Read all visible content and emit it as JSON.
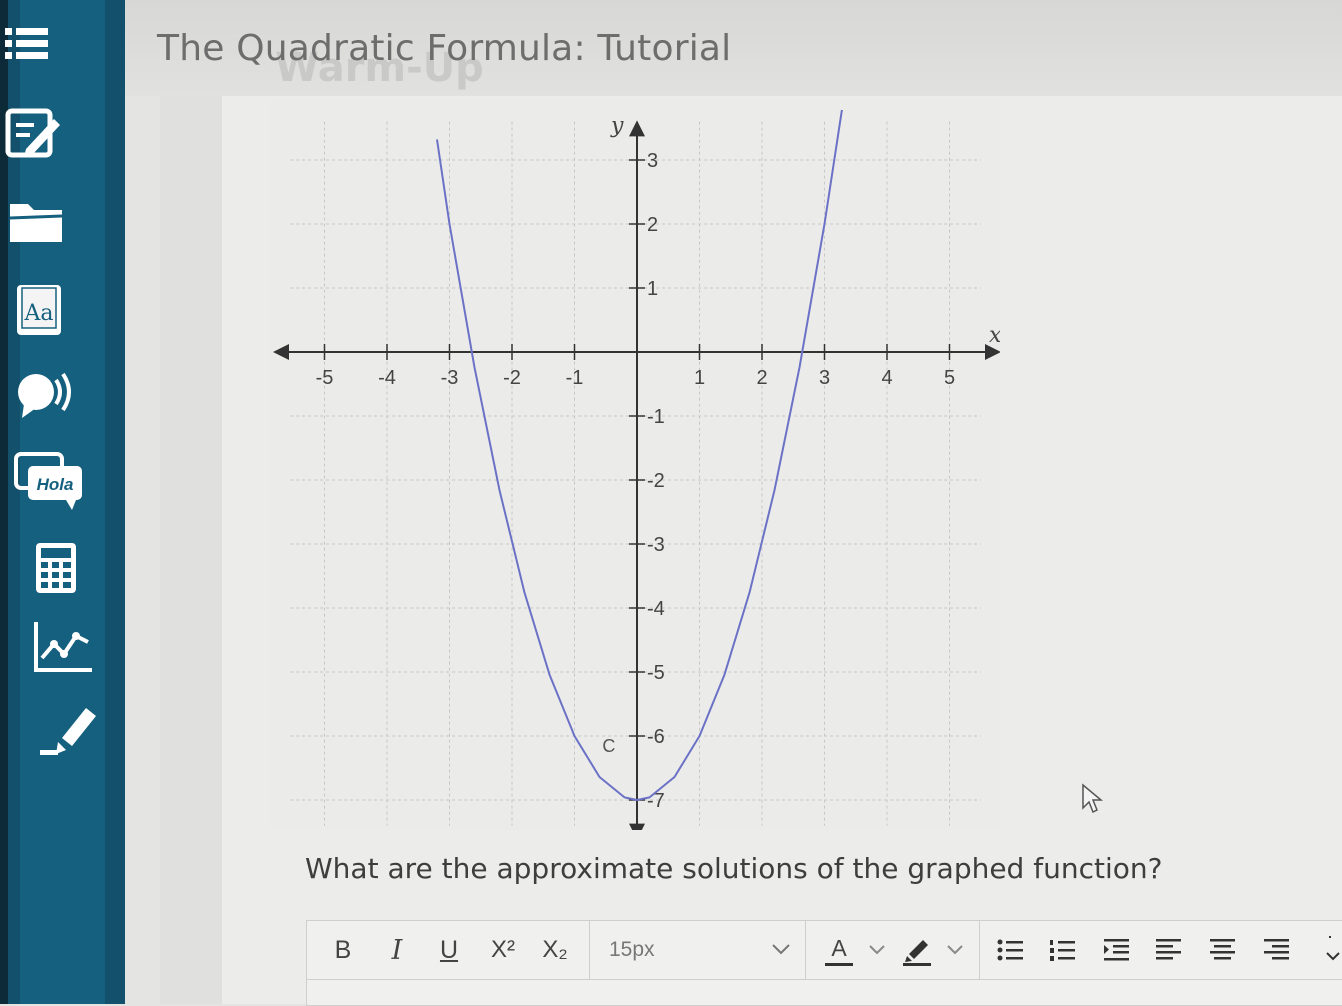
{
  "header": {
    "title": "The Quadratic Formula: Tutorial",
    "ghost_title": "Warm-Up"
  },
  "sidebar": {
    "tools": [
      {
        "name": "menu-icon"
      },
      {
        "name": "notes-icon"
      },
      {
        "name": "folder-icon"
      },
      {
        "name": "dictionary-icon",
        "label": "Aa"
      },
      {
        "name": "text-to-speech-icon"
      },
      {
        "name": "translation-icon",
        "label": "Hola"
      },
      {
        "name": "calculator-icon"
      },
      {
        "name": "graphing-icon"
      },
      {
        "name": "highlighter-icon"
      }
    ]
  },
  "chart_data": {
    "type": "line",
    "xlabel": "x",
    "ylabel": "y",
    "xlim": [
      -5,
      5
    ],
    "ylim": [
      -7,
      3
    ],
    "x_ticks": [
      -5,
      -4,
      -3,
      -2,
      -1,
      1,
      2,
      3,
      4,
      5
    ],
    "y_ticks": [
      3,
      2,
      1,
      -1,
      -2,
      -3,
      -4,
      -5,
      -6,
      -7
    ],
    "grid": true,
    "series": [
      {
        "x": [
          -3.2,
          -3,
          -2.6,
          -2.2,
          -1.8,
          -1.4,
          -1,
          -0.6,
          -0.2,
          0,
          0.2,
          0.6,
          1,
          1.4,
          1.8,
          2.2,
          2.6,
          3,
          3.4
        ],
        "y": [
          3.32,
          2.0,
          -0.24,
          -2.16,
          -3.76,
          -5.04,
          -6.0,
          -6.64,
          -6.96,
          -7.0,
          -6.96,
          -6.64,
          -6.0,
          -5.04,
          -3.76,
          -2.16,
          -0.24,
          2.0,
          4.56
        ],
        "color": "#6b72c6"
      }
    ],
    "annotations": [
      {
        "text": "C",
        "x": -0.45,
        "y": -6.25
      }
    ]
  },
  "question": {
    "text": "What are the approximate solutions of the graphed function?"
  },
  "toolbar": {
    "bold": "B",
    "italic": "I",
    "underline": "U",
    "superscript": "X²",
    "subscript": "X₂",
    "font_size": "15px",
    "font_color": "A"
  }
}
